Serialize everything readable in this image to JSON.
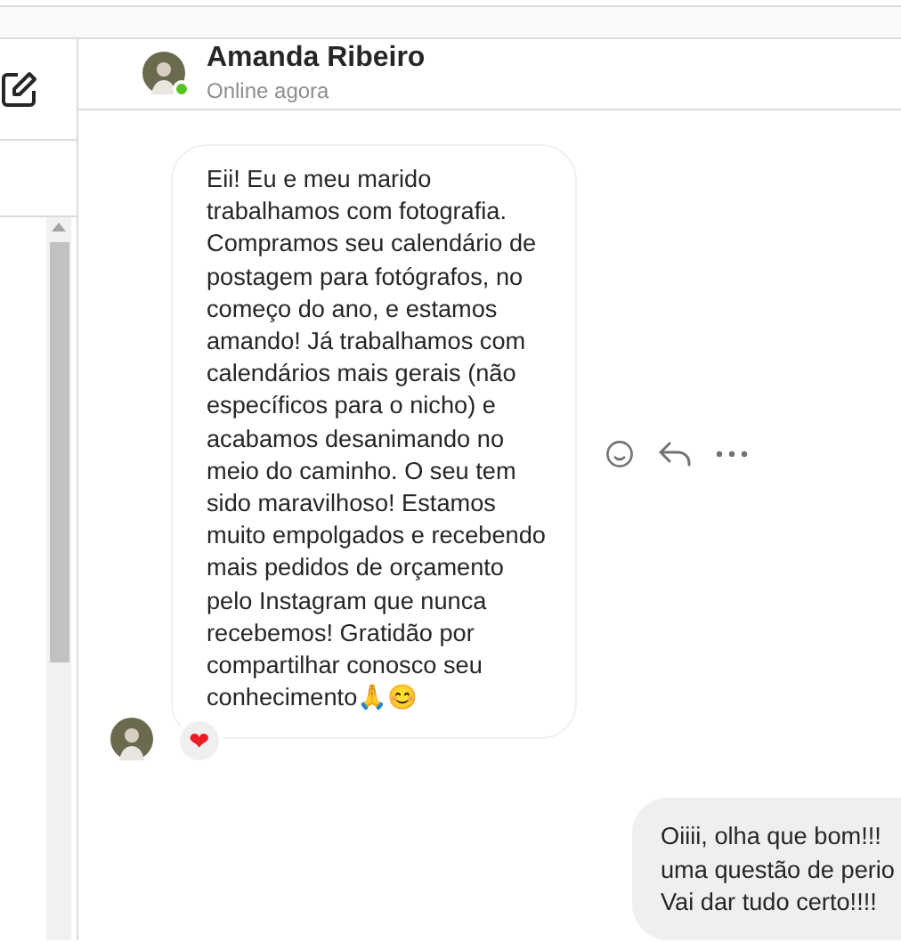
{
  "chat_header": {
    "name": "Amanda Ribeiro",
    "status": "Online agora",
    "online": true
  },
  "messages": [
    {
      "kind": "incoming",
      "lines": [
        "Eii! Eu e meu marido",
        "trabalhamos com fotografia.",
        "Compramos seu calendário de",
        "postagem para fotógrafos, no",
        "começo do ano, e estamos",
        "amando! Já trabalhamos com",
        "calendários mais gerais (não",
        "específicos para o nicho) e",
        "acabamos desanimando no",
        "meio do caminho. O seu tem",
        "sido maravilhoso! Estamos",
        "muito empolgados e recebendo",
        "mais pedidos de orçamento",
        "pelo Instagram que nunca",
        "recebemos! Gratidão por",
        "compartilhar conosco seu",
        "conhecimento🙏😊"
      ],
      "reaction": "❤"
    },
    {
      "kind": "outgoing",
      "lines": [
        "Oiiii, olha que bom!!!",
        "uma questão de perio",
        "Vai dar tudo certo!!!!"
      ]
    }
  ]
}
